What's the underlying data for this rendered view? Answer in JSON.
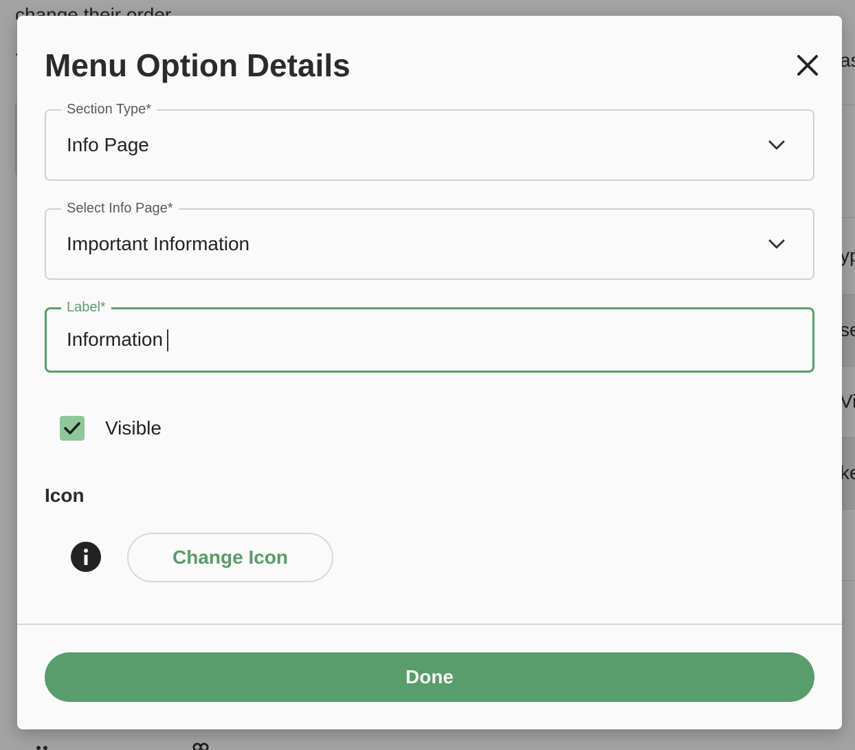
{
  "background": {
    "top_text": "change their order",
    "right_edge_fragments": [
      "as",
      "yp",
      "se",
      "Vid",
      "ke"
    ]
  },
  "dialog": {
    "title": "Menu Option Details",
    "close_icon": "close-icon",
    "section_type": {
      "label": "Section Type*",
      "value": "Info Page"
    },
    "info_page": {
      "label": "Select Info Page*",
      "value": "Important Information"
    },
    "label_field": {
      "label": "Label*",
      "value": "Information"
    },
    "visible": {
      "label": "Visible",
      "checked": true
    },
    "icon_section": {
      "heading": "Icon",
      "current_icon": "info-icon",
      "change_button": "Change Icon"
    },
    "done_button": "Done"
  },
  "colors": {
    "accent": "#589d6a",
    "checkbox_fill": "#8fc79b",
    "overlay": "#a3a3a3",
    "dialog_bg": "#fafafa"
  }
}
